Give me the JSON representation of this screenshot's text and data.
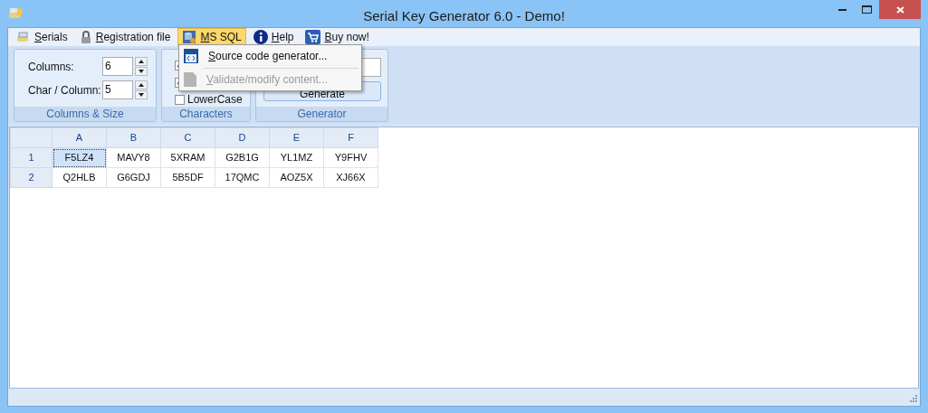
{
  "window": {
    "title": "Serial Key Generator 6.0 - Demo!"
  },
  "menu": [
    {
      "label": "Serials",
      "kind": "serials",
      "selected": false,
      "underlined_first": true
    },
    {
      "label": "Registration file",
      "kind": "lock",
      "selected": false,
      "underlined_first": true
    },
    {
      "label": "MS SQL",
      "kind": "database",
      "selected": true,
      "underlined_first": true
    },
    {
      "label": "Help",
      "kind": "info",
      "selected": false,
      "underlined_first": true
    },
    {
      "label": "Buy now!",
      "kind": "cart",
      "selected": false,
      "underlined_first": true
    }
  ],
  "dropdown": [
    {
      "label": "Source code generator...",
      "kind": "code",
      "disabled": false,
      "underlined_first": true
    },
    {
      "label": "Validate/modify content...",
      "kind": "page",
      "disabled": true,
      "underlined_first": true
    }
  ],
  "columns_size": {
    "caption": "Columns & Size",
    "fields": [
      {
        "label": "Columns:",
        "value": "6"
      },
      {
        "label": "Char / Column:",
        "value": "5"
      }
    ]
  },
  "characters": {
    "caption": "Characters",
    "checkboxes": [
      {
        "checked": true
      },
      {
        "checked": true
      },
      {
        "label": "LowerCase",
        "checked": false
      }
    ]
  },
  "generator": {
    "caption": "Generator",
    "button": "Generate"
  },
  "grid": {
    "columns": [
      "A",
      "B",
      "C",
      "D",
      "E",
      "F"
    ],
    "rows": [
      {
        "header": "1",
        "cells": [
          {
            "text": "F5LZ4",
            "selected": true
          },
          {
            "text": "MAVY8",
            "selected": false
          },
          {
            "text": "5XRAM",
            "selected": false
          },
          {
            "text": "G2B1G",
            "selected": false
          },
          {
            "text": "YL1MZ",
            "selected": false
          },
          {
            "text": "Y9FHV",
            "selected": false
          }
        ]
      },
      {
        "header": "2",
        "cells": [
          {
            "text": "Q2HLB",
            "selected": false
          },
          {
            "text": "G6GDJ",
            "selected": false
          },
          {
            "text": "5B5DF",
            "selected": false
          },
          {
            "text": "17QMC",
            "selected": false
          },
          {
            "text": "AOZ5X",
            "selected": false
          },
          {
            "text": "XJ66X",
            "selected": false
          }
        ]
      }
    ]
  }
}
